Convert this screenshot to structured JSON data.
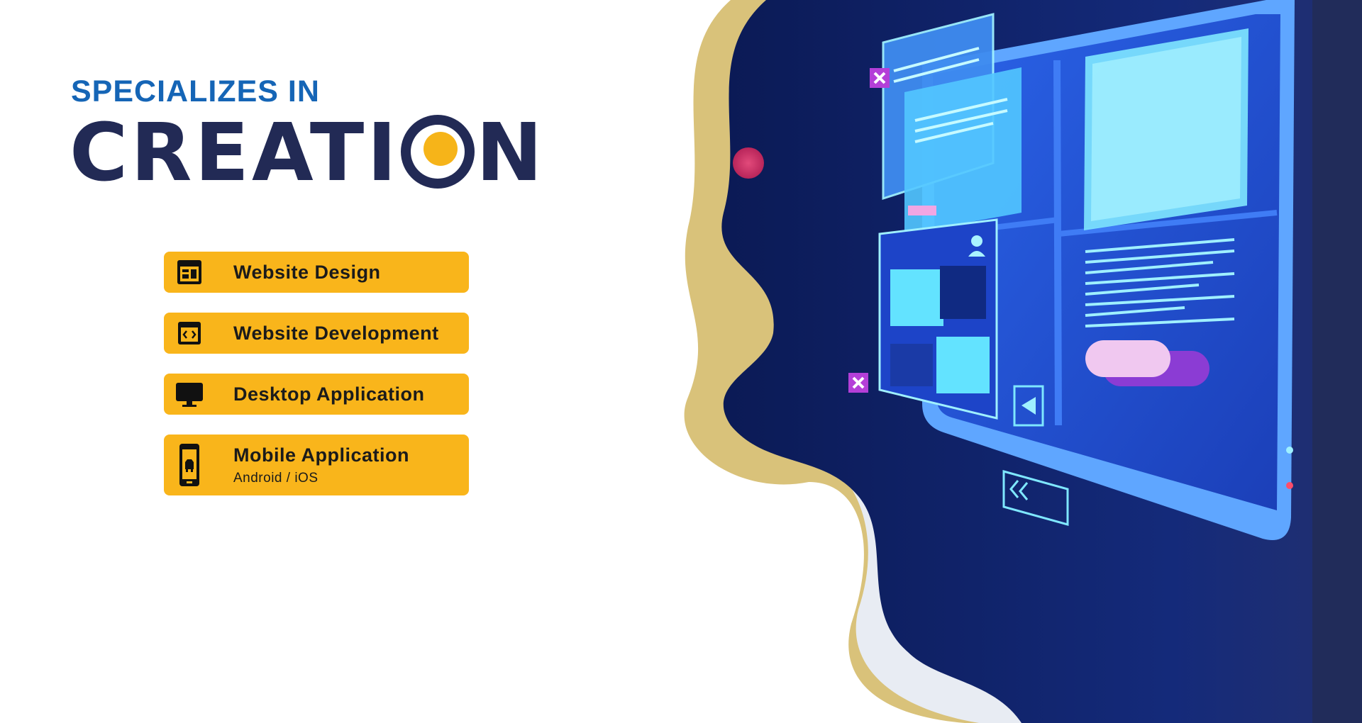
{
  "heading": {
    "kicker": "SPECIALIZES IN",
    "title_part1": "CREATI",
    "title_part2": "N"
  },
  "services": [
    {
      "label": "Website Design",
      "icon": "website-layout-icon"
    },
    {
      "label": "Website Development",
      "icon": "code-window-icon"
    },
    {
      "label": "Desktop Application",
      "icon": "desktop-monitor-icon"
    },
    {
      "label": "Mobile Application",
      "sublabel": "Android / iOS",
      "icon": "mobile-phone-icon"
    }
  ],
  "colors": {
    "accent_yellow": "#f9b51b",
    "heading_blue": "#1565b6",
    "title_navy": "#222a55",
    "illustration_navy": "#10215e",
    "screen_blue": "#2a6cf0",
    "sand": "#d9c27a"
  }
}
